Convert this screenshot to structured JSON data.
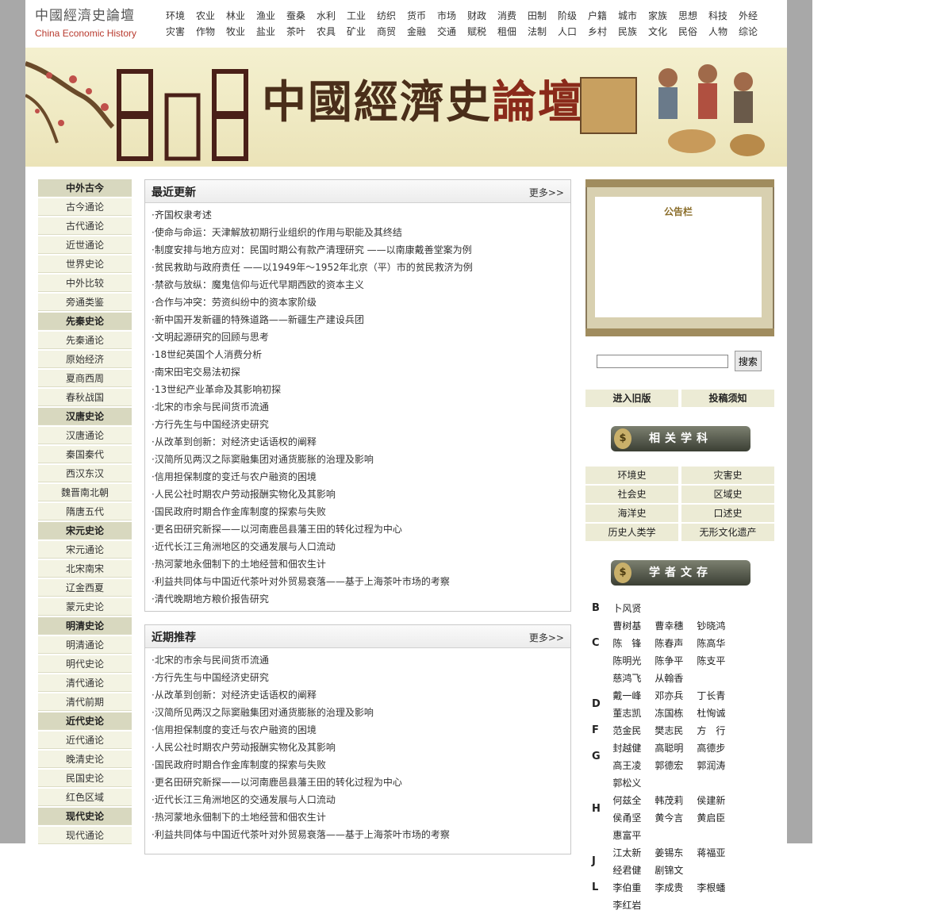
{
  "logo": {
    "cn": "中國經濟史論壇",
    "en": "China Economic History"
  },
  "topnav": {
    "row1": [
      "环境",
      "农业",
      "林业",
      "渔业",
      "蚕桑",
      "水利",
      "工业",
      "纺织",
      "货币",
      "市场",
      "财政",
      "消费",
      "田制",
      "阶级",
      "户籍",
      "城市",
      "家族",
      "思想",
      "科技",
      "外经"
    ],
    "row2": [
      "灾害",
      "作物",
      "牧业",
      "盐业",
      "茶叶",
      "农具",
      "矿业",
      "商贸",
      "金融",
      "交通",
      "赋税",
      "租佃",
      "法制",
      "人口",
      "乡村",
      "民族",
      "文化",
      "民俗",
      "人物",
      "综论"
    ]
  },
  "banner": {
    "title_a": "中國經濟史",
    "title_b": "論壇"
  },
  "leftnav": [
    {
      "label": "中外古今",
      "head": true
    },
    {
      "label": "古今通论"
    },
    {
      "label": "古代通论"
    },
    {
      "label": "近世通论"
    },
    {
      "label": "世界史论"
    },
    {
      "label": "中外比较"
    },
    {
      "label": "旁通类鉴"
    },
    {
      "label": "先秦史论",
      "head": true
    },
    {
      "label": "先秦通论"
    },
    {
      "label": "原始经济"
    },
    {
      "label": "夏商西周"
    },
    {
      "label": "春秋战国"
    },
    {
      "label": "汉唐史论",
      "head": true
    },
    {
      "label": "汉唐通论"
    },
    {
      "label": "秦国秦代"
    },
    {
      "label": "西汉东汉"
    },
    {
      "label": "魏晋南北朝"
    },
    {
      "label": "隋唐五代"
    },
    {
      "label": "宋元史论",
      "head": true
    },
    {
      "label": "宋元通论"
    },
    {
      "label": "北宋南宋"
    },
    {
      "label": "辽金西夏"
    },
    {
      "label": "蒙元史论"
    },
    {
      "label": "明清史论",
      "head": true
    },
    {
      "label": "明清通论"
    },
    {
      "label": "明代史论"
    },
    {
      "label": "清代通论"
    },
    {
      "label": "清代前期"
    },
    {
      "label": "近代史论",
      "head": true
    },
    {
      "label": "近代通论"
    },
    {
      "label": "晚清史论"
    },
    {
      "label": "民国史论"
    },
    {
      "label": "红色区域"
    },
    {
      "label": "现代史论",
      "head": true
    },
    {
      "label": "现代通论"
    }
  ],
  "latest": {
    "title": "最近更新",
    "more": "更多>>",
    "items": [
      "·齐国权隶考述",
      "·使命与命运：天津解放初期行业组织的作用与职能及其终结",
      "·制度安排与地方应对：民国时期公有款产清理研究 ——以南康戴善堂案为例",
      "·贫民救助与政府责任 ——以1949年～1952年北京（平）市的贫民救济为例",
      "·禁欲与放纵：魔鬼信仰与近代早期西欧的资本主义",
      "·合作与冲突：劳资纠纷中的资本家阶级",
      "·新中国开发新疆的特殊道路——新疆生产建设兵团",
      "·文明起源研究的回顾与思考",
      "·18世纪英国个人消费分析",
      "·南宋田宅交易法初探",
      "·13世纪产业革命及其影响初探",
      "·北宋的市余与民间货币流通",
      "·方行先生与中国经济史研究",
      "·从改革到创新：对经济史话语权的阐释",
      "·汉简所见两汉之际窦融集团对通货膨胀的治理及影响",
      "·信用担保制度的变迁与农户融资的困境",
      "·人民公社时期农户劳动报酬实物化及其影响",
      "·国民政府时期合作金库制度的探索与失败",
      "·更名田研究新探——以河南鹿邑县藩王田的转化过程为中心",
      "·近代长江三角洲地区的交通发展与人口流动",
      "·热河蒙地永佃制下的土地经营和佃农生计",
      "·利益共同体与中国近代茶叶对外贸易衰落——基于上海茶叶市场的考察",
      "·清代晚期地方粮价报告研究"
    ]
  },
  "recommended": {
    "title": "近期推荐",
    "more": "更多>>",
    "items": [
      "·北宋的市余与民间货币流通",
      "·方行先生与中国经济史研究",
      "·从改革到创新：对经济史话语权的阐释",
      "·汉简所见两汉之际窦融集团对通货膨胀的治理及影响",
      "·信用担保制度的变迁与农户融资的困境",
      "·人民公社时期农户劳动报酬实物化及其影响",
      "·国民政府时期合作金库制度的探索与失败",
      "·更名田研究新探——以河南鹿邑县藩王田的转化过程为中心",
      "·近代长江三角洲地区的交通发展与人口流动",
      "·热河蒙地永佃制下的土地经营和佃农生计",
      "·利益共同体与中国近代茶叶对外贸易衰落——基于上海茶叶市场的考察"
    ]
  },
  "bulletin": {
    "title": "公告栏"
  },
  "search": {
    "placeholder": "",
    "button": "搜索"
  },
  "buttons": {
    "old": "进入旧版",
    "guide": "投稿须知"
  },
  "related": {
    "title": "相关学科",
    "icon": "$"
  },
  "subjects": [
    "环境史",
    "灾害史",
    "社会史",
    "区域史",
    "海洋史",
    "口述史",
    "历史人类学",
    "无形文化遗产"
  ],
  "scholars": {
    "title": "学者文存",
    "icon": "$"
  },
  "authors": [
    {
      "letter": "B",
      "names": [
        "卜风贤"
      ]
    },
    {
      "letter": "C",
      "names": [
        "曹树基",
        "曹幸穗",
        "钞晓鸿",
        "陈　锋",
        "陈春声",
        "陈高华",
        "陈明光",
        "陈争平",
        "陈支平",
        "慈鸿飞",
        "从翰香"
      ]
    },
    {
      "letter": "D",
      "names": [
        "戴一峰",
        "邓亦兵",
        "丁长青",
        "董志凯",
        "冻国栋",
        "杜恂诚"
      ]
    },
    {
      "letter": "F",
      "names": [
        "范金民",
        "樊志民",
        "方　行"
      ]
    },
    {
      "letter": "G",
      "names": [
        "封越健",
        "高聪明",
        "高德步",
        "高王凌",
        "郭德宏",
        "郭润涛",
        "郭松义"
      ]
    },
    {
      "letter": "H",
      "names": [
        "何兹全",
        "韩茂莉",
        "侯建新",
        "侯甬坚",
        "黄今言",
        "黄启臣",
        "惠富平"
      ]
    },
    {
      "letter": "J",
      "names": [
        "江太新",
        "姜锡东",
        "蒋福亚",
        "经君健",
        "剧锦文"
      ]
    },
    {
      "letter": "L",
      "names": [
        "李伯重",
        "李成贵",
        "李根蟠",
        "李红岩"
      ]
    }
  ]
}
